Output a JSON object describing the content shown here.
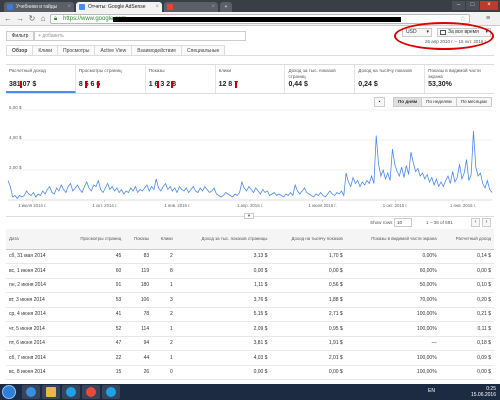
{
  "browser": {
    "tabs": [
      {
        "label": "Учебники и гайды",
        "active": false,
        "icon_color": "#3b7bd6"
      },
      {
        "label": "Отчеты: Google AdSense",
        "active": true,
        "icon_color": "#4a8af4"
      },
      {
        "label": "",
        "active": false,
        "icon_color": "#ea4335"
      }
    ],
    "url": "https://www.google.com"
  },
  "header": {
    "filter_label": "Фильтр",
    "filter_placeholder": "+ добавить",
    "currency": "USD",
    "period": "За все время",
    "date_range": "26 апр 2010 г. – 15 окт. 2016 г."
  },
  "report_tabs": [
    "Обзор",
    "Клики",
    "Просмотры",
    "Active View",
    "Взаимодействие",
    "Специальные"
  ],
  "metrics": [
    {
      "label": "Расчетный доход",
      "value": "381,07 $"
    },
    {
      "label": "Просмотры страниц",
      "value": "8 6 6 6"
    },
    {
      "label": "Показы",
      "value": "1 6 3 2 8"
    },
    {
      "label": "Клики",
      "value": "12 8 7"
    },
    {
      "label": "Доход за тыс. показов страниц",
      "value": "0,44 $"
    },
    {
      "label": "Доход на тысячу показов",
      "value": "0,24 $"
    },
    {
      "label": "Показы в видимой части экрана",
      "value": "53,30%"
    }
  ],
  "granularity": [
    "По дням",
    "По неделям",
    "По месяцам"
  ],
  "chart_data": {
    "type": "line",
    "ylabel": "",
    "yticks": [
      "6,00 $",
      "4,00 $",
      "2,00 $"
    ],
    "xticks": [
      "1 июля 2014 г.",
      "1 окт. 2014 г.",
      "1 янв. 2015 г.",
      "1 апр. 2015 г.",
      "1 июля 2015 г.",
      "1 окт. 2015 г.",
      "1 янв. 2016 г."
    ],
    "ylim": [
      0,
      6
    ],
    "grid": true,
    "color": "#4a8af4",
    "series": [
      {
        "values": [
          1.3,
          0.9,
          0.2,
          0.3,
          0.1,
          0.3,
          0.2,
          0.3,
          0.6,
          0.4,
          0.3,
          0.5,
          0.2,
          0.4,
          0.3,
          0.6,
          0.4,
          0.7,
          0.9,
          0.5,
          0.4,
          0.8,
          0.6,
          1.0,
          0.7,
          0.5,
          0.9,
          1.1,
          0.6,
          0.8,
          1.0,
          0.7,
          0.5,
          0.9,
          1.2,
          0.8,
          0.6,
          1.0,
          0.9,
          1.3,
          0.7,
          0.5,
          0.8,
          1.1,
          0.7,
          0.9,
          0.6,
          0.8,
          0.5,
          0.7,
          0.4,
          0.6,
          0.5,
          0.8,
          0.6,
          0.9,
          0.5,
          0.7,
          0.6,
          0.8,
          1.0,
          0.6,
          0.9,
          0.7,
          1.4,
          0.8,
          0.6,
          0.9,
          1.1,
          0.7,
          0.9,
          0.6,
          0.8,
          0.5,
          0.9,
          0.7,
          0.6,
          0.8,
          0.5,
          0.7,
          0.9,
          0.6,
          0.5,
          0.8,
          0.6,
          0.9,
          0.7,
          0.5,
          0.6,
          0.8,
          0.4,
          0.3,
          0.2,
          0.3,
          0.5,
          0.4,
          0.3,
          0.2,
          0.4,
          0.3,
          0.5,
          1.2,
          0.8,
          0.6,
          0.9,
          0.7,
          0.5,
          0.8,
          0.6,
          0.4,
          0.7,
          0.5,
          0.6,
          0.3,
          0.4,
          0.5,
          0.3,
          0.4,
          0.3,
          0.2,
          0.4,
          0.3,
          0.5,
          0.3,
          1.0,
          0.6,
          0.4,
          0.6,
          0.8,
          0.5,
          0.4,
          0.3,
          0.2,
          0.4,
          0.3,
          0.5,
          0.3,
          0.2,
          0.4,
          0.6,
          0.4,
          0.3,
          0.5,
          0.4,
          0.6,
          0.3,
          1.8,
          1.2,
          0.9,
          1.5,
          1.1,
          1.3,
          0.9,
          1.2,
          1.0,
          1.3,
          1.1,
          1.6,
          1.1,
          4.3,
          2.4,
          1.6,
          2.0,
          1.4,
          1.8,
          1.3,
          3.4,
          2.4,
          1.9,
          1.6,
          2.2,
          1.5,
          2.3,
          1.7,
          3.2,
          2.5,
          1.9,
          2.1,
          1.6,
          1.8,
          1.4,
          1.7,
          1.2,
          1.5,
          1.0,
          1.4,
          0.9,
          1.2,
          0.9,
          1.3,
          1.6,
          1.1,
          1.9,
          1.2,
          1.5,
          2.4,
          1.4,
          1.8,
          2.7,
          1.3,
          1.7,
          4.6,
          2.2,
          1.6,
          1.8,
          1.1,
          0.8,
          1.3,
          0.7,
          0.5
        ]
      }
    ]
  },
  "table_controls": {
    "show_rows_label": "Show rows",
    "show_rows_value": "10",
    "page_info": "1 – 36 of 591"
  },
  "table": {
    "columns": [
      "Дата",
      "Просмотры страниц",
      "Показы",
      "Клики",
      "Доход за тыс. показов страницы",
      "Доход на тысячу показов",
      "Показы в видимой части экрана",
      "Расчетный доход"
    ],
    "rows": [
      [
        "сб, 31 мая 2014",
        "45",
        "83",
        "2",
        "3,13 $",
        "1,70 $",
        "0,00%",
        "0,14 $"
      ],
      [
        "вс, 1 июня 2014",
        "60",
        "119",
        "8",
        "0,00 $",
        "0,00 $",
        "60,00%",
        "0,00 $"
      ],
      [
        "пн, 2 июня 2014",
        "91",
        "180",
        "1",
        "1,11 $",
        "0,56 $",
        "50,00%",
        "0,10 $"
      ],
      [
        "вт, 3 июня 2014",
        "53",
        "106",
        "3",
        "3,76 $",
        "1,88 $",
        "70,00%",
        "0,20 $"
      ],
      [
        "ср, 4 июня 2014",
        "41",
        "78",
        "2",
        "5,15 $",
        "2,71 $",
        "100,00%",
        "0,21 $"
      ],
      [
        "чт, 5 июня 2014",
        "52",
        "114",
        "1",
        "2,09 $",
        "0,95 $",
        "100,00%",
        "0,11 $"
      ],
      [
        "пт, 6 июня 2014",
        "47",
        "94",
        "2",
        "3,81 $",
        "1,91 $",
        "—",
        "0,18 $"
      ],
      [
        "сб, 7 июня 2014",
        "22",
        "44",
        "1",
        "4,03 $",
        "2,01 $",
        "100,00%",
        "0,09 $"
      ],
      [
        "вс, 8 июня 2014",
        "15",
        "26",
        "0",
        "0,00 $",
        "0,00 $",
        "100,00%",
        "0,00 $"
      ],
      [
        "пн, 9 июня 2014",
        "93",
        "189",
        "0",
        "0,00 $",
        "0,00 $",
        "—",
        "0,00 $"
      ]
    ]
  },
  "taskbar": {
    "lang": "EN",
    "time": "0:25",
    "date": "15.06.2016"
  }
}
